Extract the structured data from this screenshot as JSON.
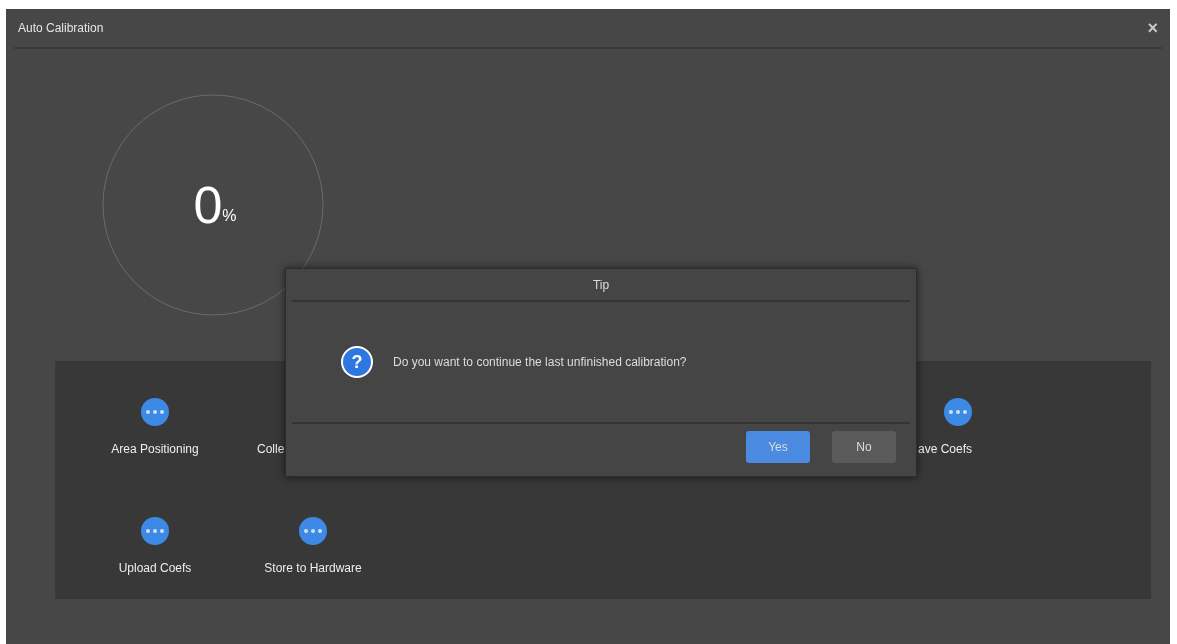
{
  "window": {
    "title": "Auto Calibration",
    "close": "×"
  },
  "progress": {
    "level": 0,
    "value": "0",
    "unit": "%"
  },
  "step_rows": [
    [
      {
        "label": "Area Positioning",
        "kind": "step"
      },
      {
        "label": "Colle",
        "kind": "rightcovered"
      },
      {
        "label": "ave Coefs",
        "kind": "leftcovered"
      }
    ],
    [
      {
        "label": "Upload Coefs",
        "kind": "step"
      },
      {
        "label": "Store to Hardware",
        "kind": "step"
      }
    ]
  ],
  "dialog": {
    "title": "Tip",
    "icon": "?",
    "message": "Do you want to continue the last unfinished calibration?",
    "buttons": [
      {
        "label": "Yes",
        "primary": true
      },
      {
        "label": "No",
        "primary": false
      }
    ]
  }
}
